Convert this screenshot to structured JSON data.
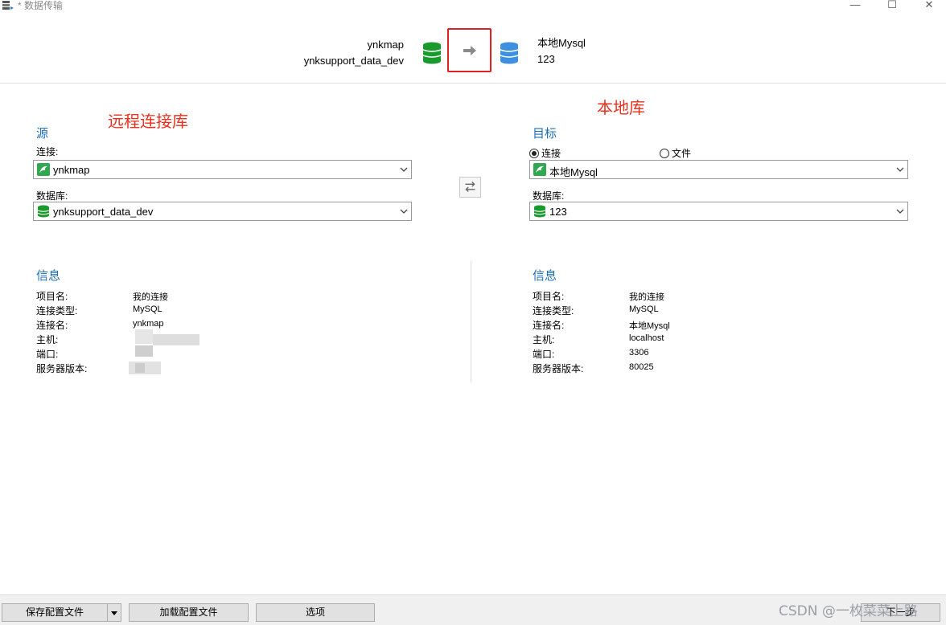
{
  "window": {
    "title": "* 数据传输",
    "controls": {
      "minimize": "—",
      "maximize": "☐",
      "close": "✕"
    }
  },
  "transfer_summary": {
    "source_connection": "ynkmap",
    "source_database": "ynksupport_data_dev",
    "target_connection": "本地Mysql",
    "target_database": "123"
  },
  "annotations": {
    "remote_label": "远程连接库",
    "local_label": "本地库"
  },
  "source": {
    "section_title": "源",
    "connection_label": "连接:",
    "connection_value": "ynkmap",
    "database_label": "数据库:",
    "database_value": "ynksupport_data_dev"
  },
  "target": {
    "section_title": "目标",
    "radio_connection": "连接",
    "radio_file": "文件",
    "selected_mode": "连接",
    "connection_value": "本地Mysql",
    "database_label": "数据库:",
    "database_value": "123"
  },
  "source_info": {
    "section_title": "信息",
    "rows": [
      {
        "key": "项目名:",
        "value": "我的连接"
      },
      {
        "key": "连接类型:",
        "value": "MySQL"
      },
      {
        "key": "连接名:",
        "value": "ynkmap"
      },
      {
        "key": "主机:",
        "value": ""
      },
      {
        "key": "端口:",
        "value": ""
      },
      {
        "key": "服务器版本:",
        "value": ""
      }
    ]
  },
  "target_info": {
    "section_title": "信息",
    "rows": [
      {
        "key": "项目名:",
        "value": "我的连接"
      },
      {
        "key": "连接类型:",
        "value": "MySQL"
      },
      {
        "key": "连接名:",
        "value": "本地Mysql"
      },
      {
        "key": "主机:",
        "value": "localhost"
      },
      {
        "key": "端口:",
        "value": "3306"
      },
      {
        "key": "服务器版本:",
        "value": "80025"
      }
    ]
  },
  "footer": {
    "save_config": "保存配置文件",
    "load_config": "加载配置文件",
    "options": "选项",
    "next": "下一步"
  },
  "watermark": "CSDN @一枚菜菜上路",
  "colors": {
    "accent_blue": "#1d6fb8",
    "annotation_red": "#e8301c",
    "source_db_green": "#1a9a2c",
    "target_db_blue": "#3d8fe0"
  }
}
